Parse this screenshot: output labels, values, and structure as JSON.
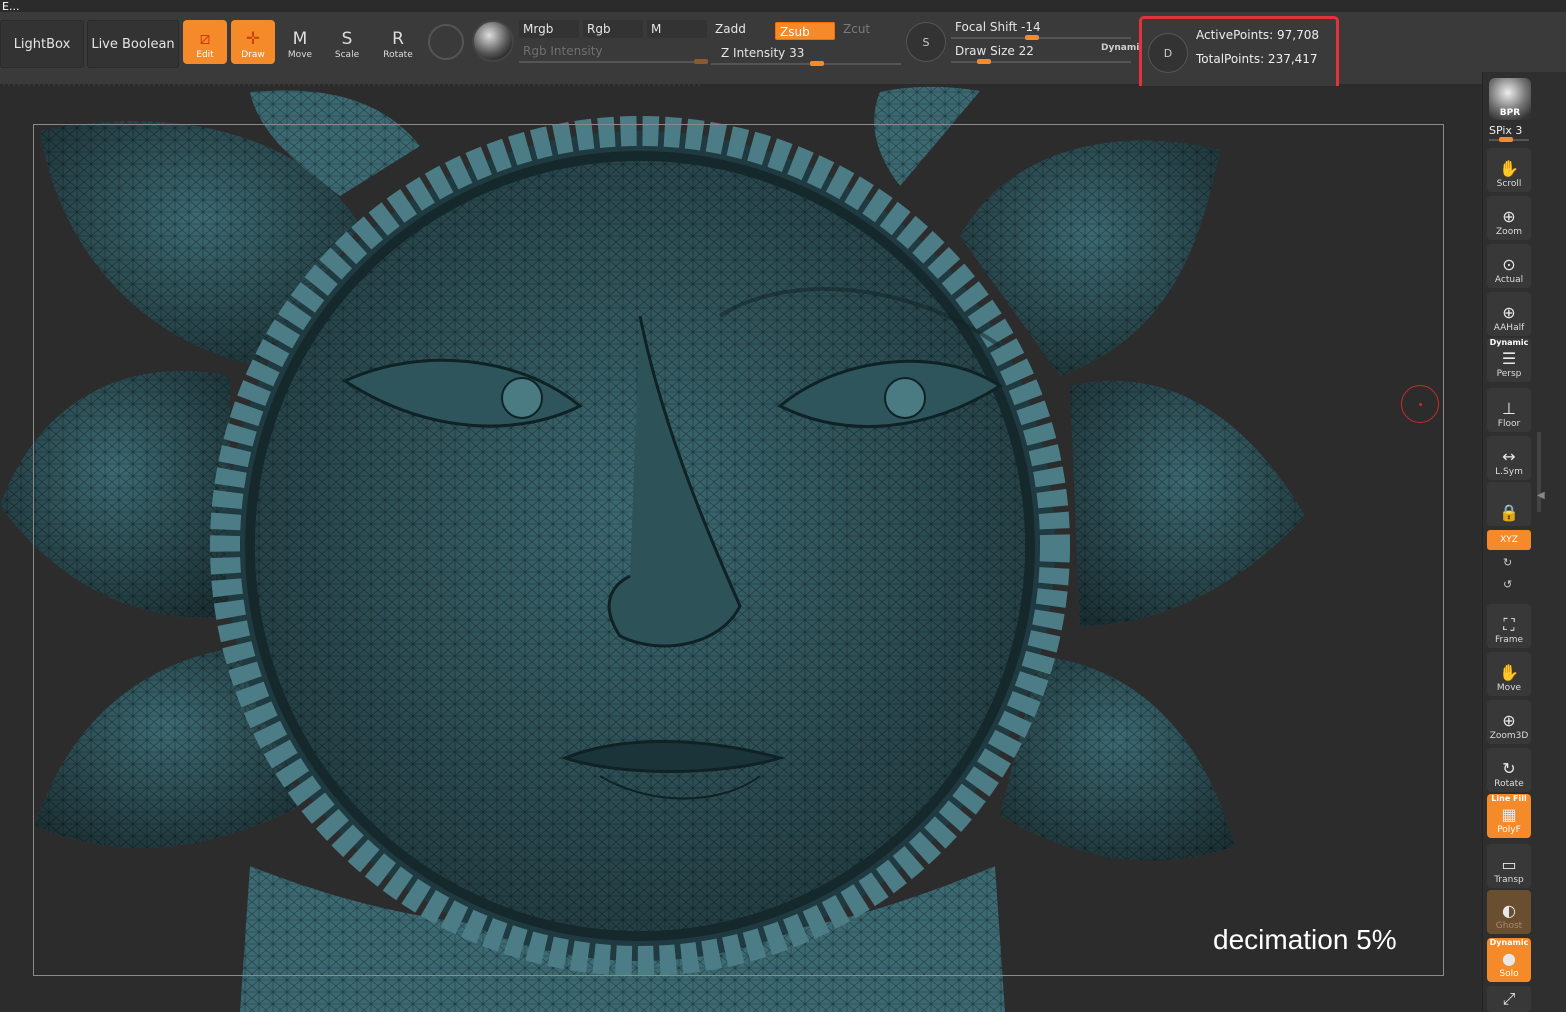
{
  "title_fragment": "E...",
  "toolbar": {
    "lightbox_label": "LightBox",
    "live_boolean_label": "Live Boolean",
    "tools": [
      {
        "label": "Edit",
        "glyph": "⧄",
        "active": true
      },
      {
        "label": "Draw",
        "glyph": "✛",
        "active": true
      },
      {
        "label": "Move",
        "glyph": "M",
        "active": false
      },
      {
        "label": "Scale",
        "glyph": "S",
        "active": false
      },
      {
        "label": "Rotate",
        "glyph": "R",
        "active": false
      }
    ],
    "mrgb_label": "Mrgb",
    "rgb_label": "Rgb",
    "m_label": "M",
    "zadd_label": "Zadd",
    "zsub_label": "Zsub",
    "zcut_label": "Zcut",
    "rgb_intensity_label": "Rgb Intensity",
    "z_intensity_label": "Z Intensity 33",
    "focal_shift_label": "Focal Shift -14",
    "draw_size_label": "Draw Size 22",
    "dynamic_label": "Dynamic",
    "stroke_icon_s": "S",
    "stroke_icon_d": "D",
    "active_points": "ActivePoints: 97,708",
    "total_points": "TotalPoints: 237,417",
    "accent_color": "#f58a2b",
    "highlight_color": "#e0333a"
  },
  "viewport": {
    "caption": "decimation 5%"
  },
  "shelf": {
    "bpr_label": "BPR",
    "spix_label": "SPix 3",
    "buttons": [
      {
        "label": "Scroll",
        "glyph": "✋",
        "name": "scroll"
      },
      {
        "label": "Zoom",
        "glyph": "⊕",
        "name": "zoom"
      },
      {
        "label": "Actual",
        "glyph": "⊙",
        "name": "actual"
      },
      {
        "label": "AAHalf",
        "glyph": "⊕",
        "name": "aahalf"
      },
      {
        "label": "Persp",
        "glyph": "☰",
        "name": "persp",
        "top_label": "Dynamic"
      },
      {
        "label": "Floor",
        "glyph": "⊥",
        "name": "floor"
      },
      {
        "label": "L.Sym",
        "glyph": "↔",
        "name": "lsym"
      },
      {
        "label": "",
        "glyph": "🔒",
        "name": "lock"
      }
    ],
    "xyz_label": "XYZ",
    "buttons2": [
      {
        "label": "Frame",
        "glyph": "⛶",
        "name": "frame"
      },
      {
        "label": "Move",
        "glyph": "✋",
        "name": "move"
      },
      {
        "label": "Zoom3D",
        "glyph": "⊕",
        "name": "zoom3d"
      },
      {
        "label": "Rotate",
        "glyph": "↻",
        "name": "rotate"
      },
      {
        "label": "PolyF",
        "glyph": "▦",
        "name": "polyf",
        "top_label": "Line Fill"
      },
      {
        "label": "Transp",
        "glyph": "▭",
        "name": "transp"
      },
      {
        "label": "Ghost",
        "glyph": "◐",
        "name": "ghost"
      },
      {
        "label": "Solo",
        "glyph": "●",
        "name": "solo",
        "top_label": "Dynamic"
      }
    ]
  }
}
